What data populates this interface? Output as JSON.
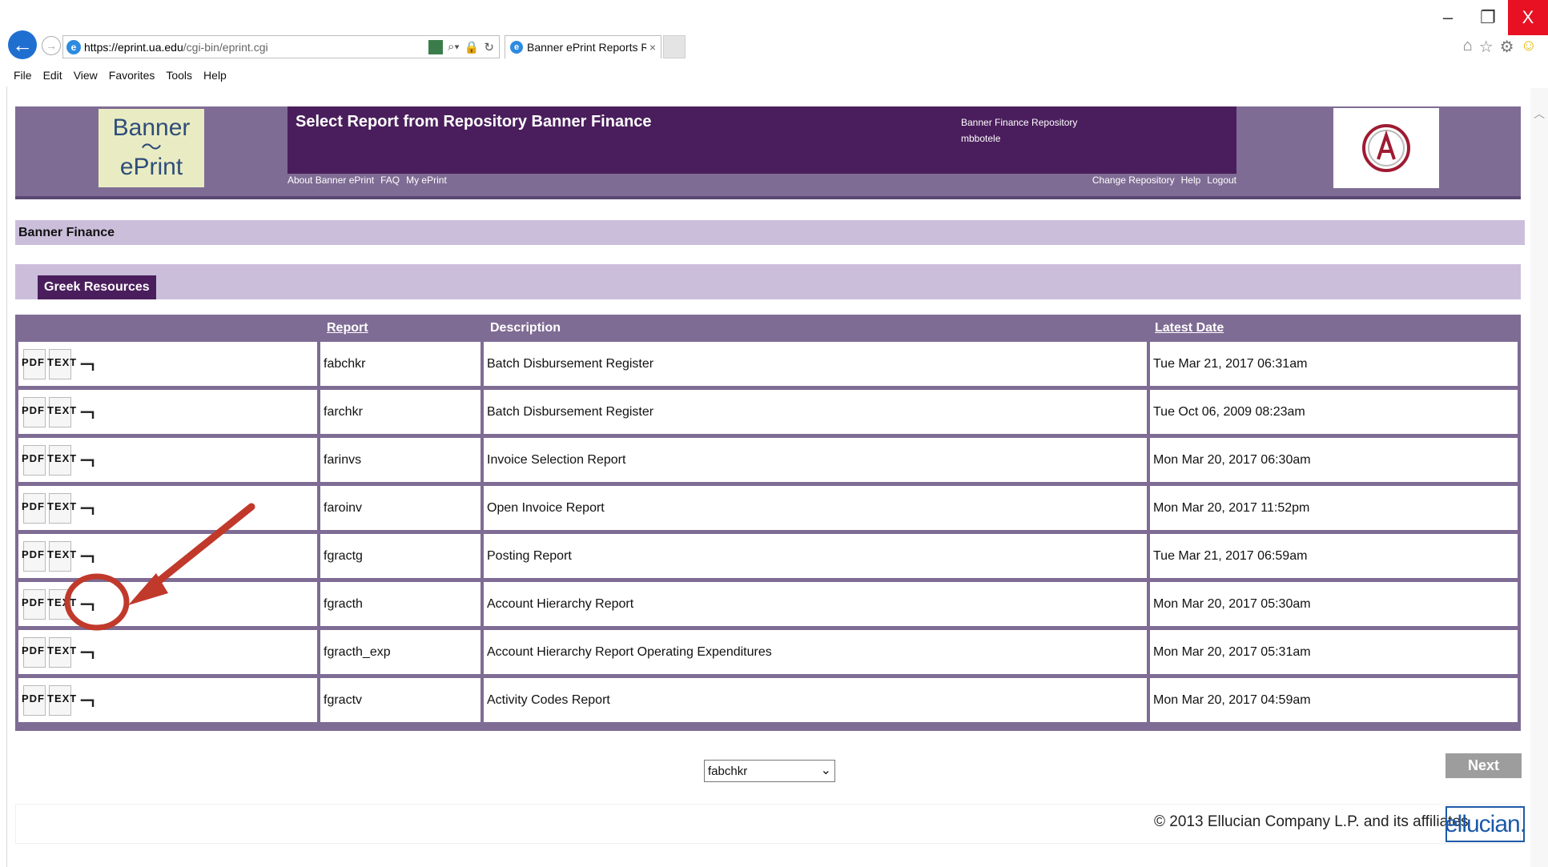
{
  "browser": {
    "url_host": "https://eprint.ua.edu",
    "url_path": "/cgi-bin/eprint.cgi",
    "tab_title": "Banner ePrint Reports Repo...",
    "tab_close": "×",
    "menu": [
      "File",
      "Edit",
      "View",
      "Favorites",
      "Tools",
      "Help"
    ],
    "window_minimize": "–",
    "window_restore": "❐",
    "window_close": "X"
  },
  "header": {
    "logo_line1": "Banner",
    "logo_line2": "ePrint",
    "title": "Select Report from Repository Banner Finance",
    "repository_name": "Banner Finance Repository",
    "user": "mbbotele",
    "left_links": [
      "About Banner ePrint",
      "FAQ",
      "My ePrint"
    ],
    "right_links": [
      "Change Repository",
      "Help",
      "Logout"
    ]
  },
  "breadcrumb": "Banner Finance",
  "section": "Greek Resources",
  "table": {
    "headers": {
      "report": "Report",
      "description": "Description",
      "latest_date": "Latest Date"
    },
    "icon_labels": {
      "pdf": "PDF",
      "text": "TEXT"
    },
    "rows": [
      {
        "report": "fabchkr",
        "description": "Batch Disbursement Register",
        "date": "Tue Mar 21, 2017 06:31am"
      },
      {
        "report": "farchkr",
        "description": "Batch Disbursement Register",
        "date": "Tue Oct 06, 2009 08:23am"
      },
      {
        "report": "farinvs",
        "description": "Invoice Selection Report",
        "date": "Mon Mar 20, 2017 06:30am"
      },
      {
        "report": "faroinv",
        "description": "Open Invoice Report",
        "date": "Mon Mar 20, 2017 11:52pm"
      },
      {
        "report": "fgractg",
        "description": "Posting Report",
        "date": "Tue Mar 21, 2017 06:59am"
      },
      {
        "report": "fgracth",
        "description": "Account Hierarchy Report",
        "date": "Mon Mar 20, 2017 05:30am"
      },
      {
        "report": "fgracth_exp",
        "description": "Account Hierarchy Report Operating Expenditures",
        "date": "Mon Mar 20, 2017 05:31am"
      },
      {
        "report": "fgractv",
        "description": "Activity Codes Report",
        "date": "Mon Mar 20, 2017 04:59am"
      }
    ]
  },
  "report_select": {
    "value": "fabchkr"
  },
  "next_label": "Next",
  "footer": {
    "copyright": "© 2013 Ellucian Company L.P. and its affiliates",
    "brand": "ellucian."
  },
  "colors": {
    "header_bg": "#7f6c94",
    "title_bar": "#4a1e5c",
    "light_band": "#cbbedb",
    "annotation": "#c0392b"
  }
}
